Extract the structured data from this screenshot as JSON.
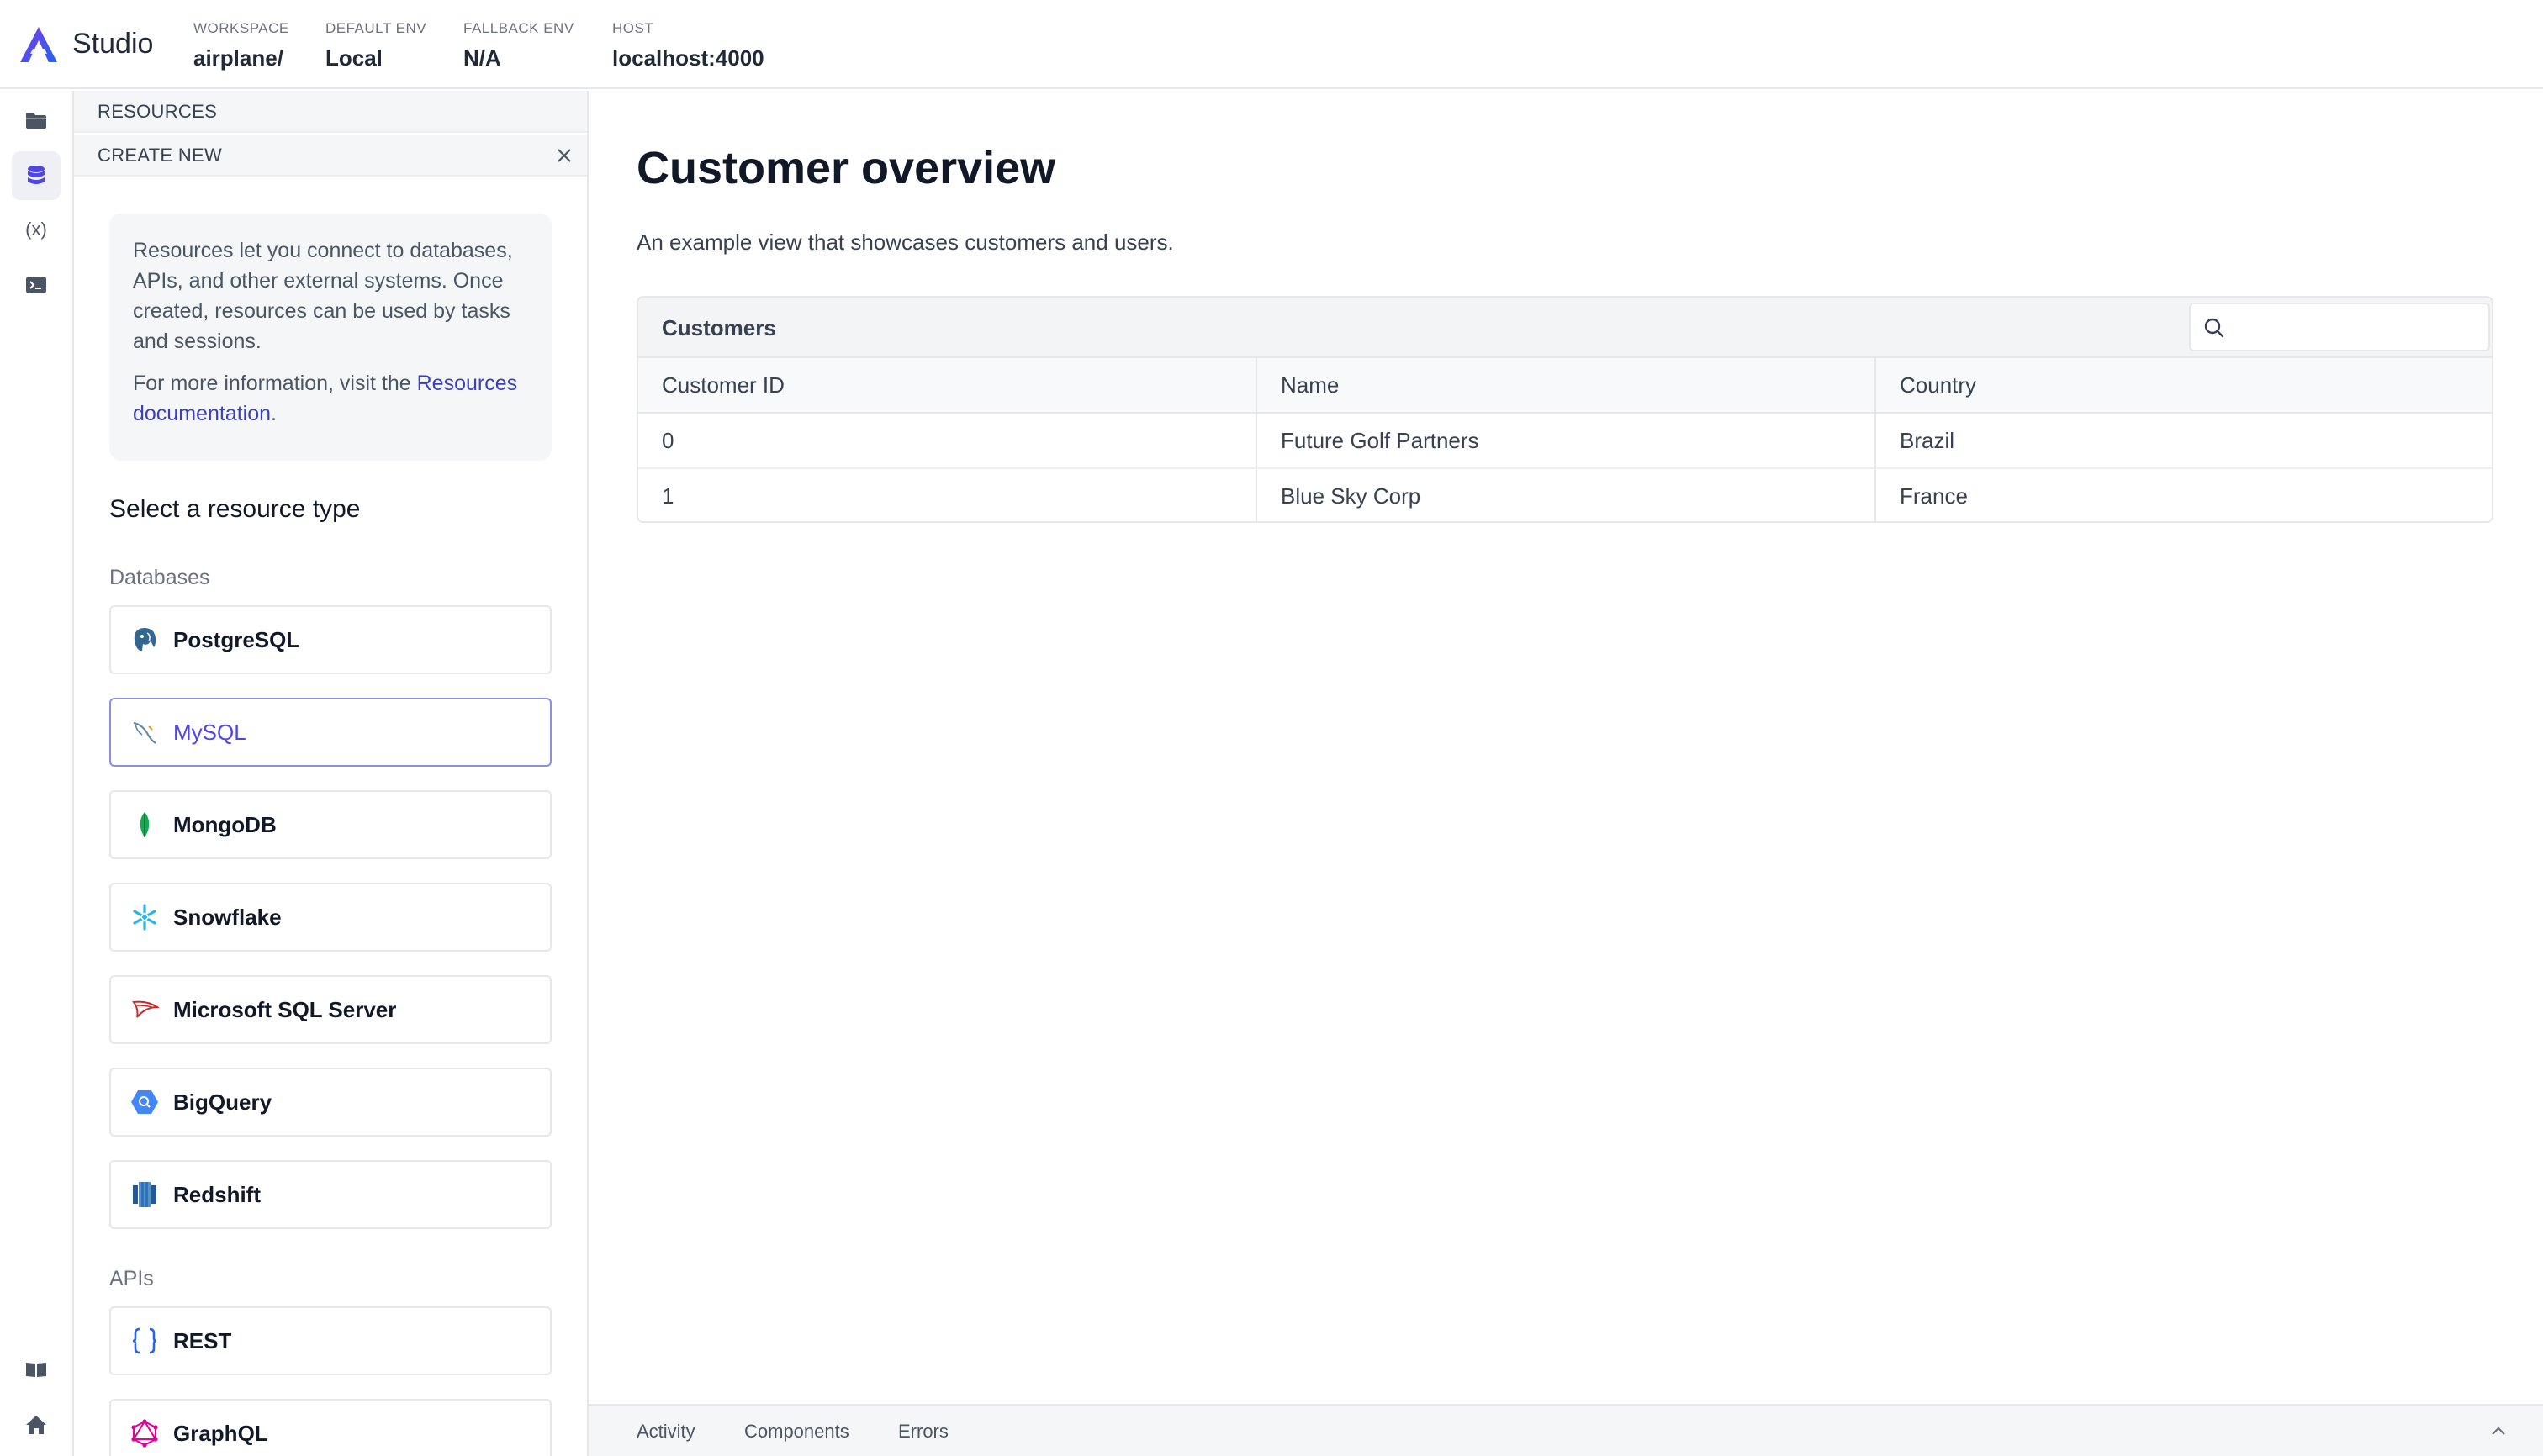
{
  "header": {
    "app_name": "Studio",
    "workspace": {
      "label": "WORKSPACE",
      "value": "airplane/"
    },
    "default_env": {
      "label": "DEFAULT ENV",
      "value": "Local"
    },
    "fallback_env": {
      "label": "FALLBACK ENV",
      "value": "N/A"
    },
    "host": {
      "label": "HOST",
      "value": "localhost:4000"
    }
  },
  "rail": {
    "items": [
      {
        "icon": "folder-icon"
      },
      {
        "icon": "database-icon",
        "active": true
      },
      {
        "icon": "variable-icon",
        "text": "(x)"
      },
      {
        "icon": "terminal-icon"
      }
    ],
    "bottom": [
      {
        "icon": "book-icon"
      },
      {
        "icon": "home-icon"
      }
    ]
  },
  "panel": {
    "crumb_resources": "RESOURCES",
    "crumb_create_new": "CREATE NEW",
    "info_text": "Resources let you connect to databases, APIs, and other external systems. Once created, resources can be used by tasks and sessions.",
    "info_more_prefix": "For more information, visit the ",
    "info_link": "Resources documentation",
    "info_more_suffix": ".",
    "select_title": "Select a resource type",
    "databases_label": "Databases",
    "databases": [
      {
        "label": "PostgreSQL",
        "icon": "postgresql-icon"
      },
      {
        "label": "MySQL",
        "icon": "mysql-icon",
        "selected": true
      },
      {
        "label": "MongoDB",
        "icon": "mongodb-icon"
      },
      {
        "label": "Snowflake",
        "icon": "snowflake-icon"
      },
      {
        "label": "Microsoft SQL Server",
        "icon": "sqlserver-icon"
      },
      {
        "label": "BigQuery",
        "icon": "bigquery-icon"
      },
      {
        "label": "Redshift",
        "icon": "redshift-icon"
      }
    ],
    "apis_label": "APIs",
    "apis": [
      {
        "label": "REST",
        "icon": "rest-icon"
      },
      {
        "label": "GraphQL",
        "icon": "graphql-icon"
      }
    ]
  },
  "main": {
    "title": "Customer overview",
    "description": "An example view that showcases customers and users.",
    "table": {
      "title": "Customers",
      "search_placeholder": "",
      "columns": [
        "Customer ID",
        "Name",
        "Country"
      ],
      "rows": [
        [
          "0",
          "Future Golf Partners",
          "Brazil"
        ],
        [
          "1",
          "Blue Sky Corp",
          "France"
        ]
      ]
    }
  },
  "bottom_bar": {
    "tabs": [
      "Activity",
      "Components",
      "Errors"
    ]
  },
  "colors": {
    "accent": "#4f46e5",
    "link": "#3b3fb9",
    "border": "#e5e7eb",
    "panel_bg": "#f5f6f8"
  }
}
